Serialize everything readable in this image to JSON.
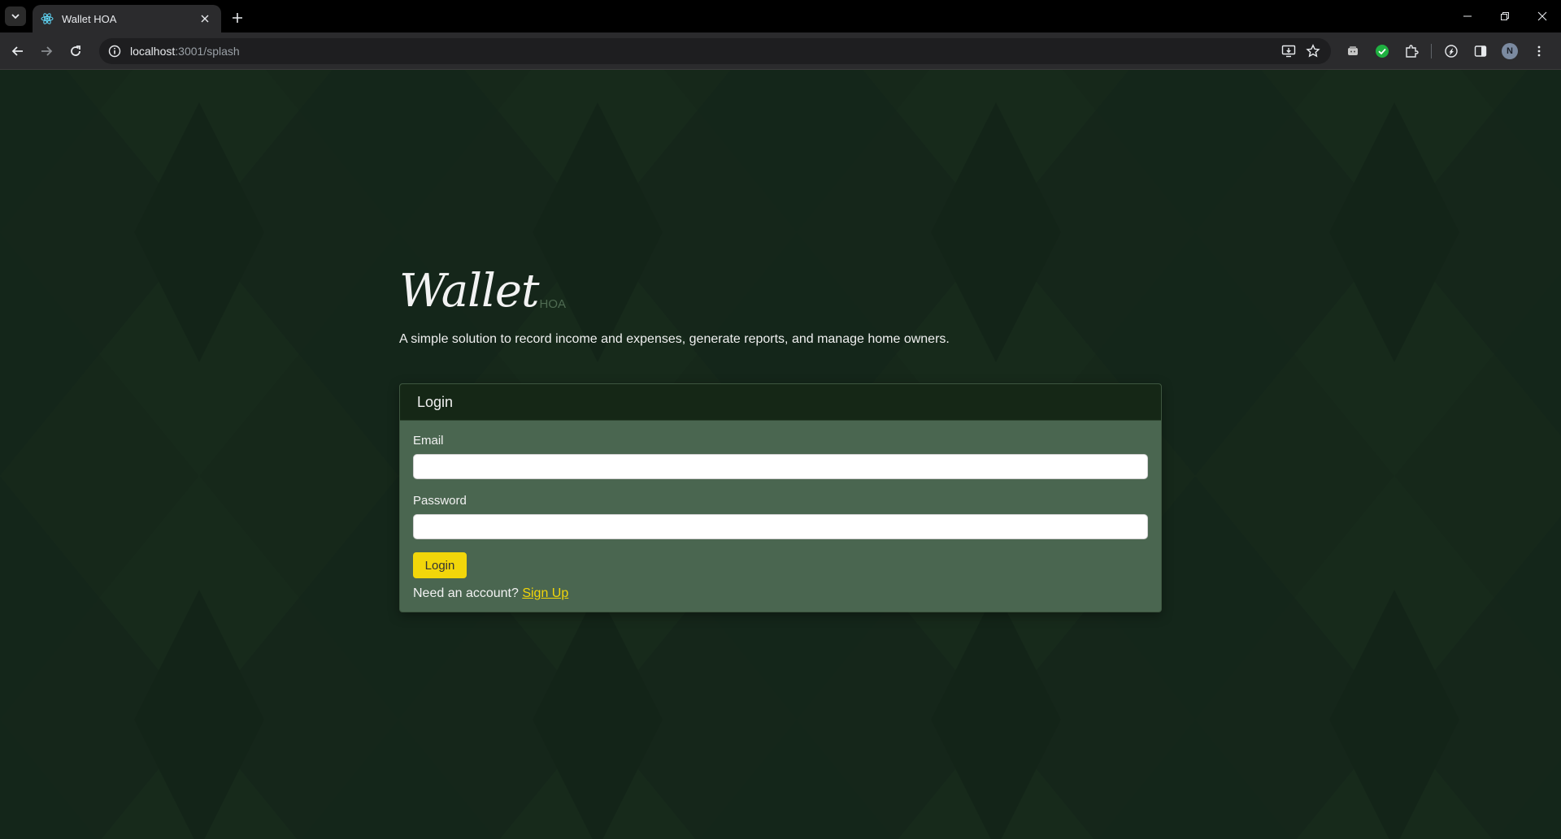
{
  "browser": {
    "tab_title": "Wallet HOA",
    "url_host": "localhost",
    "url_rest": ":3001/splash",
    "profile_initial": "N"
  },
  "brand": {
    "name": "Wallet",
    "suffix": "HOA",
    "tagline": "A simple solution to record income and expenses, generate reports, and manage home owners."
  },
  "login": {
    "title": "Login",
    "email_label": "Email",
    "email_value": "",
    "password_label": "Password",
    "password_value": "",
    "button_label": "Login",
    "signup_prompt": "Need an account?",
    "signup_link": "Sign Up"
  },
  "colors": {
    "background": "#16281a",
    "card_body": "#4a6650",
    "card_header": "#152716",
    "accent": "#f2d60a"
  }
}
